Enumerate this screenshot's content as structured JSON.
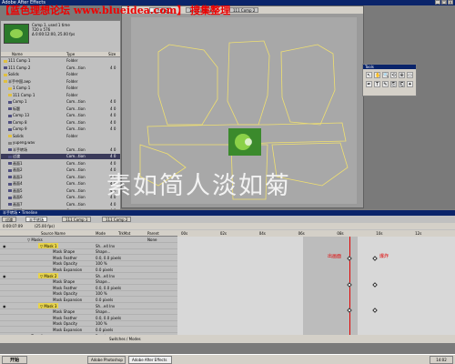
{
  "window": {
    "title": "Adobe After Effects",
    "overlay_title": "【蓝色理想论坛 www.blueidea.com】 搜集整理"
  },
  "project": {
    "info_lines": [
      "Comp 1, used 1 time",
      "720 x 576",
      "Δ 0:00:12:00, 25.00 fps"
    ],
    "headers": {
      "name": "Name",
      "type": "Type",
      "size": "Size"
    },
    "rows": [
      {
        "name": "111 Comp 1",
        "type": "Folder",
        "size": "",
        "indent": 0,
        "color": "#e0c040",
        "selected": false
      },
      {
        "name": "111 Comp 2",
        "type": "Com...tion",
        "size": "4 0",
        "indent": 0,
        "color": "#505080",
        "selected": false
      },
      {
        "name": "Solids",
        "type": "Folder",
        "size": "",
        "indent": 0,
        "color": "#e0c040",
        "selected": false
      },
      {
        "name": "半手中国.aep",
        "type": "Folder",
        "size": "",
        "indent": 0,
        "color": "#e0c040",
        "selected": false
      },
      {
        "name": "1 Comp 1",
        "type": "Folder",
        "size": "",
        "indent": 1,
        "color": "#e0c040",
        "selected": false
      },
      {
        "name": "111 Comp 1",
        "type": "Folder",
        "size": "",
        "indent": 1,
        "color": "#e0c040",
        "selected": false
      },
      {
        "name": "Comp 1",
        "type": "Com...tion",
        "size": "4 0",
        "indent": 1,
        "color": "#505080",
        "selected": false
      },
      {
        "name": "标题",
        "type": "Com...tion",
        "size": "4 0",
        "indent": 1,
        "color": "#505080",
        "selected": false
      },
      {
        "name": "Comp 13",
        "type": "Com...tion",
        "size": "4 0",
        "indent": 1,
        "color": "#505080",
        "selected": false
      },
      {
        "name": "Comp 8",
        "type": "Com...tion",
        "size": "4 0",
        "indent": 1,
        "color": "#505080",
        "selected": false
      },
      {
        "name": "Comp 9",
        "type": "Com...tion",
        "size": "4 0",
        "indent": 1,
        "color": "#505080",
        "selected": false
      },
      {
        "name": "Solids",
        "type": "Folder",
        "size": "",
        "indent": 1,
        "color": "#e0c040",
        "selected": false
      },
      {
        "name": "yupeng.wav",
        "type": "",
        "size": "",
        "indent": 1,
        "color": "#808080",
        "selected": false
      },
      {
        "name": "半手转场",
        "type": "Com...tion",
        "size": "4 0",
        "indent": 1,
        "color": "#505080",
        "selected": false
      },
      {
        "name": "过渡",
        "type": "Com...tion",
        "size": "4 0",
        "indent": 1,
        "color": "#505080",
        "selected": true
      },
      {
        "name": "画面1",
        "type": "Com...tion",
        "size": "4 0",
        "indent": 1,
        "color": "#505080",
        "selected": false
      },
      {
        "name": "画面2",
        "type": "Com...tion",
        "size": "4 0",
        "indent": 1,
        "color": "#505080",
        "selected": false
      },
      {
        "name": "画面3",
        "type": "Com...tion",
        "size": "4 0",
        "indent": 1,
        "color": "#505080",
        "selected": false
      },
      {
        "name": "画面4",
        "type": "Com...tion",
        "size": "4 0",
        "indent": 1,
        "color": "#505080",
        "selected": false
      },
      {
        "name": "画面5",
        "type": "Com...tion",
        "size": "4 0",
        "indent": 1,
        "color": "#505080",
        "selected": false
      },
      {
        "name": "画面6",
        "type": "Com...tion",
        "size": "4 0",
        "indent": 1,
        "color": "#505080",
        "selected": false
      },
      {
        "name": "画面7",
        "type": "Com...tion",
        "size": "4 0",
        "indent": 1,
        "color": "#505080",
        "selected": false
      },
      {
        "name": "画面8",
        "type": "Com...tion",
        "size": "4 0",
        "indent": 1,
        "color": "#505080",
        "selected": false
      }
    ]
  },
  "composition": {
    "tabs": [
      "半手转场",
      "111 Comp 1",
      "111 Comp 2"
    ],
    "watermark": "素如简人淡如菊"
  },
  "tools": {
    "title": "Tools",
    "glyphs": [
      "↖",
      "✋",
      "🔍",
      "⟲",
      "⊕",
      "▭",
      "✒",
      "T",
      "✎",
      "⎘",
      "⎗",
      "✦"
    ]
  },
  "timeline": {
    "title": "半手转场 • Timeline",
    "tabs": [
      "过渡",
      "半手转场",
      "111 Comp 1",
      "111 Comp 2"
    ],
    "timecode": "0:00:07:09",
    "fps": "(25.00 fps)",
    "columns": {
      "source": "Source Name",
      "mode": "Mode",
      "trkmat": "TrkMat",
      "parent": "Parent"
    },
    "parent_value": "None",
    "ruler_ticks": [
      "00s",
      "02s",
      "04s",
      "06s",
      "08s",
      "10s",
      "12s"
    ],
    "rows": [
      {
        "text": "▽ Masks",
        "indent": 5
      },
      {
        "text": "▽ Mask 1",
        "indent": 8,
        "tag": true,
        "mode": "Sh...e4 Inv"
      },
      {
        "text": "Mask Shape",
        "indent": 12,
        "mode": "Shape..."
      },
      {
        "text": "Mask Feather",
        "indent": 12,
        "mode": "0.0, 0.0 pixels"
      },
      {
        "text": "Mask Opacity",
        "indent": 12,
        "mode": "100 %"
      },
      {
        "text": "Mask Expansion",
        "indent": 12,
        "mode": "0.0 pixels"
      },
      {
        "text": "▽ Mask 2",
        "indent": 8,
        "tag": true,
        "mode": "Sh...e4 Inv"
      },
      {
        "text": "Mask Shape",
        "indent": 12,
        "mode": "Shape..."
      },
      {
        "text": "Mask Feather",
        "indent": 12,
        "mode": "0.0, 0.0 pixels"
      },
      {
        "text": "Mask Opacity",
        "indent": 12,
        "mode": "100 %"
      },
      {
        "text": "Mask Expansion",
        "indent": 12,
        "mode": "0.0 pixels"
      },
      {
        "text": "▽ Mask 3",
        "indent": 8,
        "tag": true,
        "mode": "Sh...e4 Inv"
      },
      {
        "text": "Mask Shape",
        "indent": 12,
        "mode": "Shape..."
      },
      {
        "text": "Mask Feather",
        "indent": 12,
        "mode": "0.0, 0.0 pixels"
      },
      {
        "text": "Mask Opacity",
        "indent": 12,
        "mode": "100 %"
      },
      {
        "text": "Mask Expansion",
        "indent": 12,
        "mode": "0.0 pixels"
      },
      {
        "text": "▷ Transform",
        "indent": 5,
        "mode": "Reset"
      }
    ],
    "annotation_left": "出画面",
    "annotation_right": "爆炸",
    "switches_label": "Switches / Modes"
  },
  "taskbar": {
    "start": "开始",
    "tasks": [
      "Adobe Photoshop",
      "Adobe After Effects"
    ],
    "clock": "14:02"
  }
}
